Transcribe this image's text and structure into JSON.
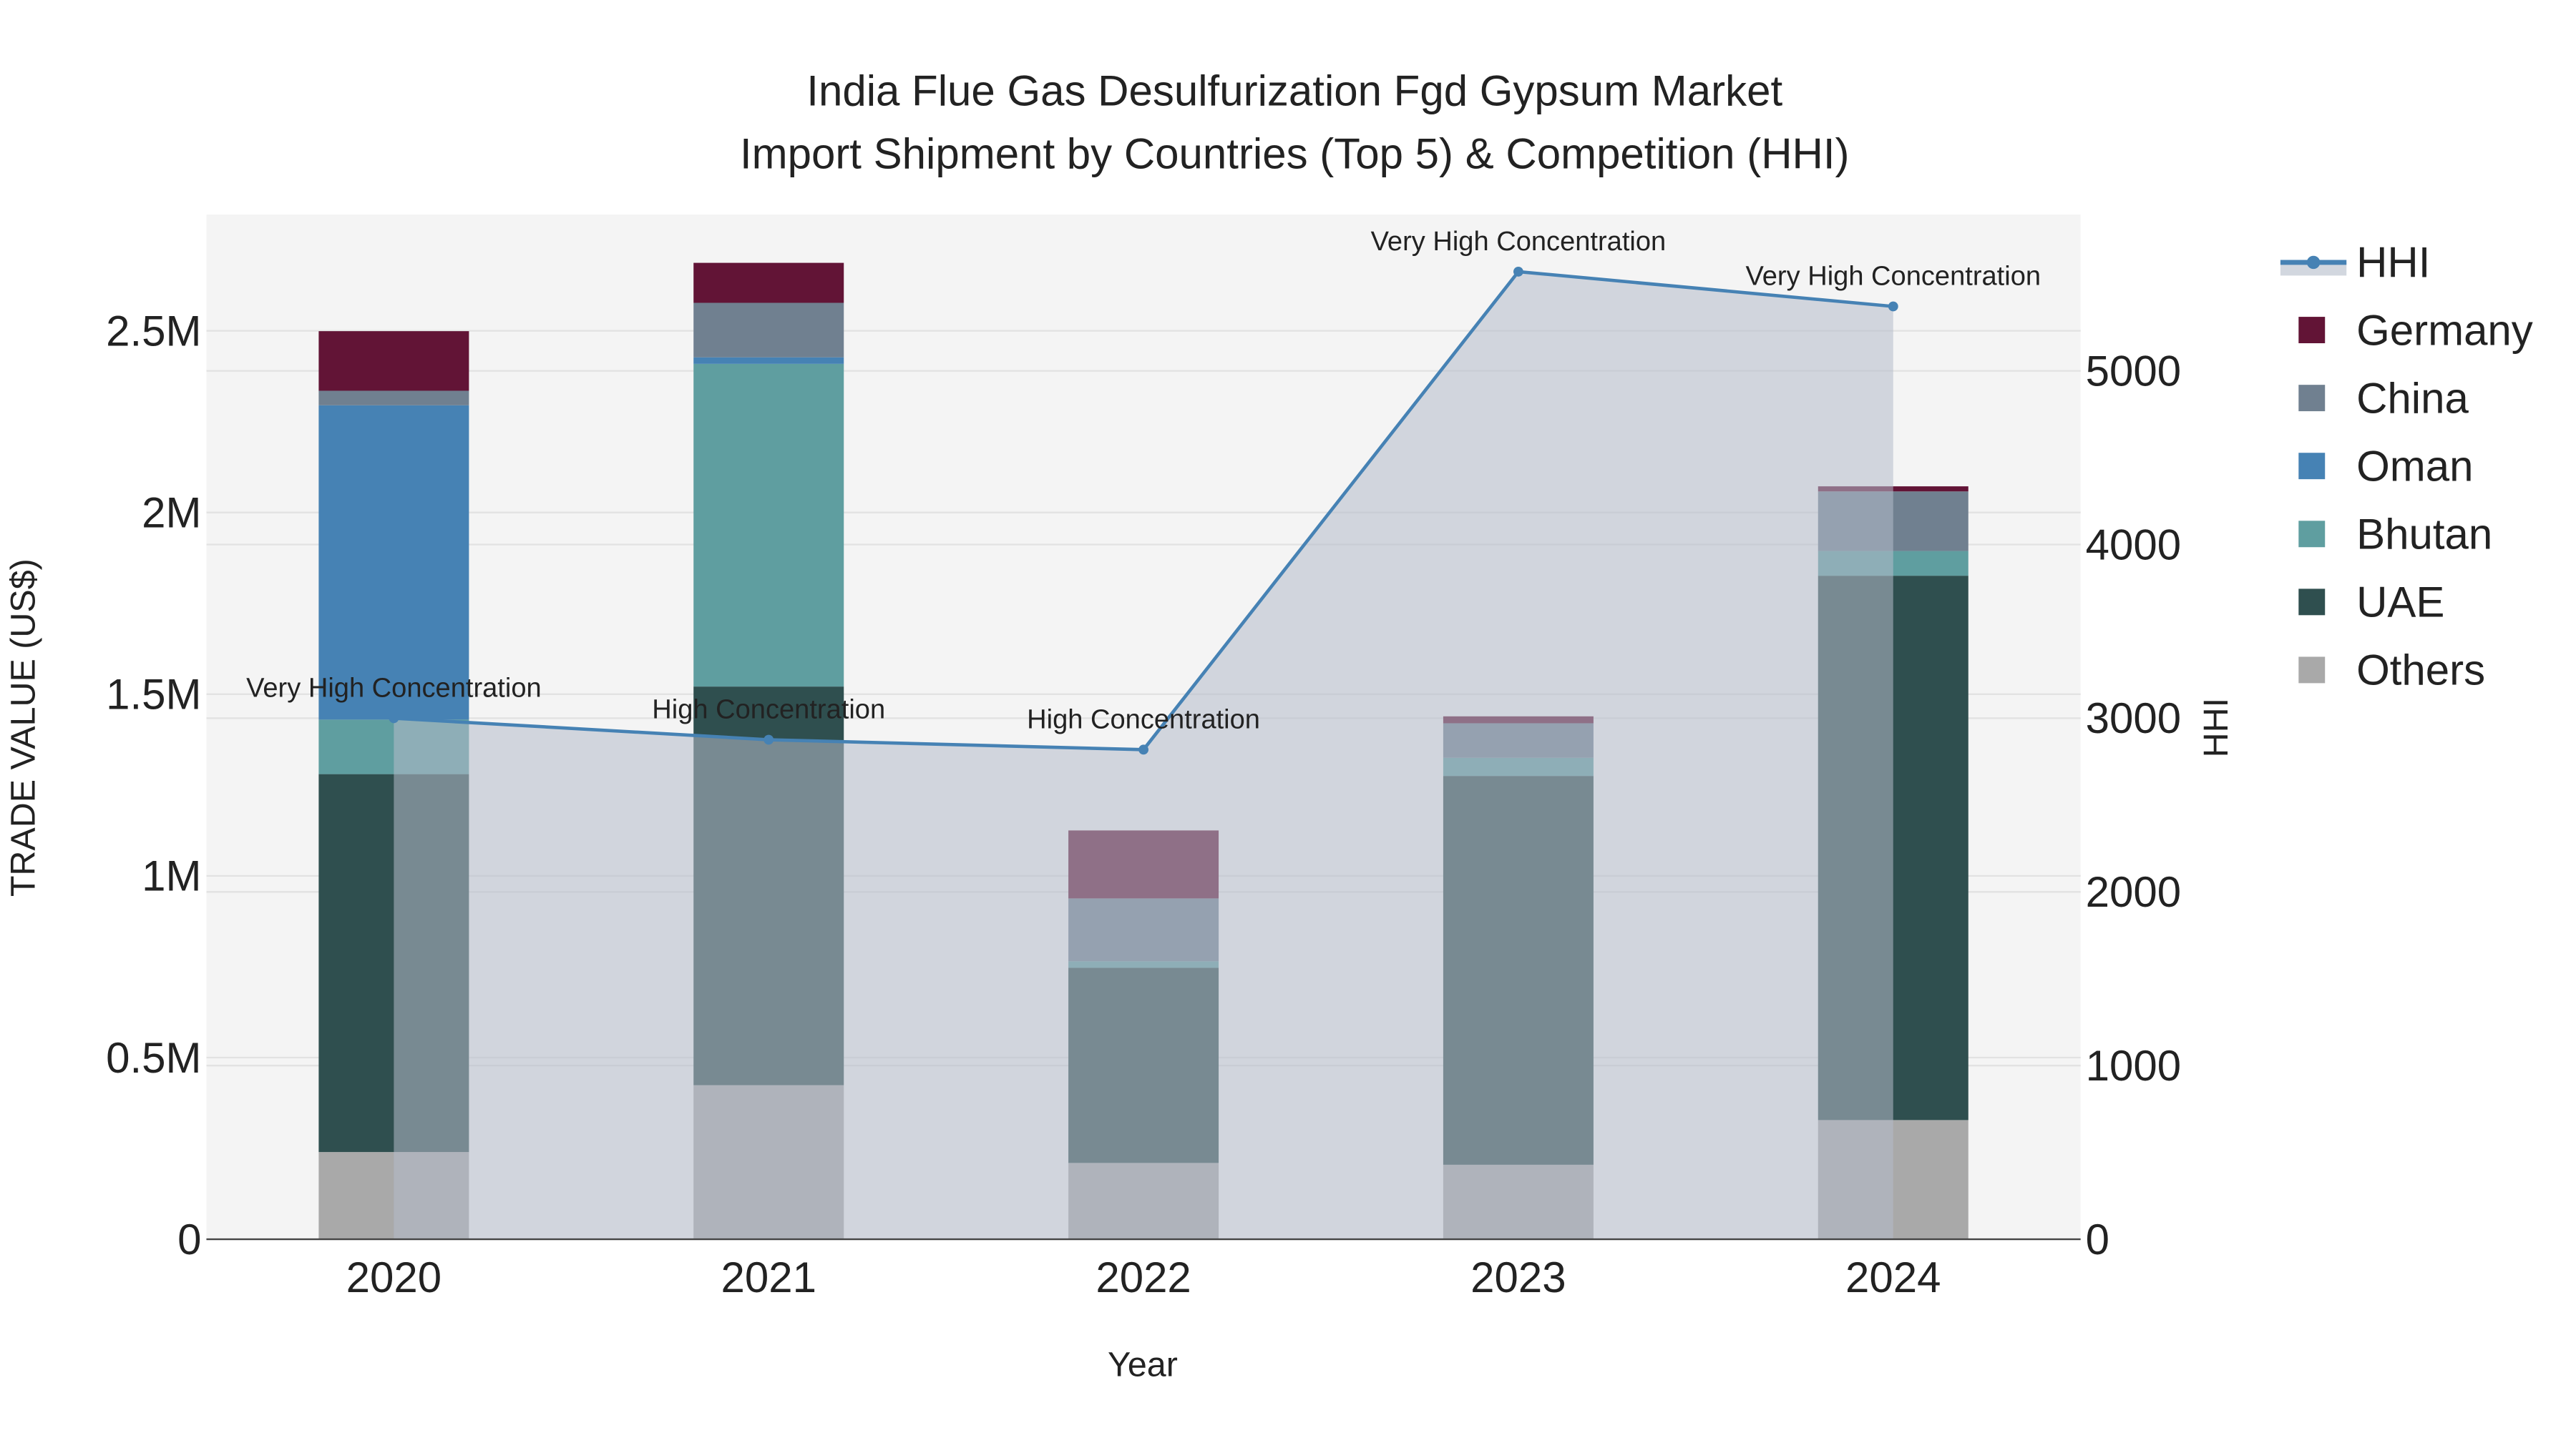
{
  "chart_data": {
    "type": "bar",
    "title_line1": "India Flue Gas Desulfurization Fgd Gypsum Market",
    "title_line2": "Import Shipment by Countries (Top 5) & Competition (HHI)",
    "xlabel": "Year",
    "ylabel": "TRADE VALUE (US$)",
    "y2label": "HHI",
    "categories": [
      "2020",
      "2021",
      "2022",
      "2023",
      "2024"
    ],
    "ylim": [
      0,
      2820000
    ],
    "y2lim": [
      0,
      5900
    ],
    "yticks": [
      {
        "v": 0,
        "label": "0"
      },
      {
        "v": 500000,
        "label": "0.5M"
      },
      {
        "v": 1000000,
        "label": "1M"
      },
      {
        "v": 1500000,
        "label": "1.5M"
      },
      {
        "v": 2000000,
        "label": "2M"
      },
      {
        "v": 2500000,
        "label": "2.5M"
      }
    ],
    "y2ticks": [
      {
        "v": 0,
        "label": "0"
      },
      {
        "v": 1000,
        "label": "1000"
      },
      {
        "v": 2000,
        "label": "2000"
      },
      {
        "v": 3000,
        "label": "3000"
      },
      {
        "v": 4000,
        "label": "4000"
      },
      {
        "v": 5000,
        "label": "5000"
      }
    ],
    "grid": true,
    "legend_position": "right",
    "series": [
      {
        "name": "Others",
        "color": "#a9a9a9",
        "values": [
          240000,
          424000,
          210000,
          205000,
          328000
        ]
      },
      {
        "name": "UAE",
        "color": "#2f4f4f",
        "values": [
          1040000,
          1097000,
          537000,
          1070000,
          1498000
        ]
      },
      {
        "name": "Bhutan",
        "color": "#5f9ea0",
        "values": [
          150000,
          888000,
          18000,
          50000,
          68000
        ]
      },
      {
        "name": "Oman",
        "color": "#4682b4",
        "values": [
          865000,
          18000,
          0,
          0,
          0
        ]
      },
      {
        "name": "China",
        "color": "#708090",
        "values": [
          40000,
          150000,
          173000,
          95000,
          164000
        ]
      },
      {
        "name": "Germany",
        "color": "#621436",
        "values": [
          164000,
          110000,
          187000,
          19000,
          14000
        ]
      }
    ],
    "hhi": {
      "name": "HHI",
      "color": "#4682b4",
      "values": [
        3000,
        2876,
        2819,
        5571,
        5371
      ],
      "annotations": [
        "Very High Concentration",
        "High Concentration",
        "High Concentration",
        "Very High Concentration",
        "Very High Concentration"
      ]
    },
    "legend_order": [
      "HHI",
      "Germany",
      "China",
      "Oman",
      "Bhutan",
      "UAE",
      "Others"
    ]
  }
}
